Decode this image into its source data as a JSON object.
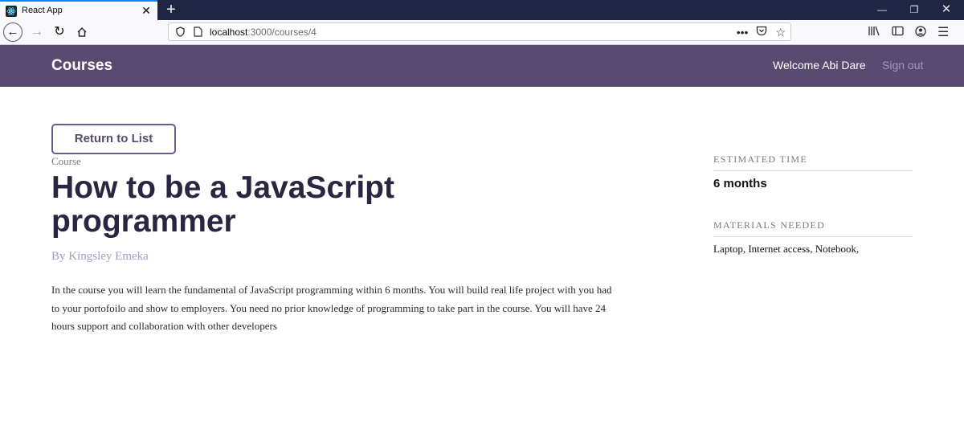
{
  "browser": {
    "tab_title": "React App",
    "url_host": "localhost",
    "url_rest": ":3000/courses/4",
    "colors": {
      "tabstrip": "#1f2542",
      "active_tab_accent": "#0a84ff"
    }
  },
  "header": {
    "brand": "Courses",
    "welcome": "Welcome Abi Dare",
    "signout": "Sign out",
    "color": "#594b6f"
  },
  "main": {
    "return_button": "Return to List",
    "course_label": "Course",
    "title": "How to be a JavaScript programmer",
    "author": "By Kingsley Emeka",
    "description": "In the course you will learn the fundamental of JavaScript programming within 6 months. You will build real life project with you had to your portofoilo and show to employers. You need no prior knowledge of programming to take part in the course. You will have 24 hours support and collaboration with other developers"
  },
  "sidebar": {
    "estimated_time_label": "ESTIMATED TIME",
    "estimated_time_value": "6 months",
    "materials_label": "MATERIALS NEEDED",
    "materials_value": "Laptop, Internet access, Notebook,"
  }
}
